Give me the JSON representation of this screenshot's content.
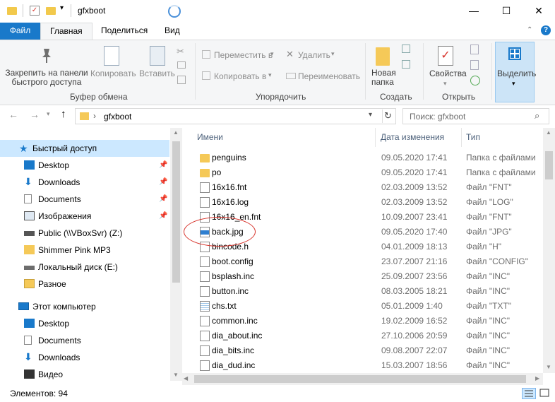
{
  "window": {
    "title": "gfxboot"
  },
  "ribbon_tabs": [
    "Файл",
    "Главная",
    "Поделиться",
    "Вид"
  ],
  "ribbon": {
    "pin_label": "Закрепить на панели быстрого доступа",
    "copy_label": "Копировать",
    "paste_label": "Вставить",
    "clipboard_group": "Буфер обмена",
    "move_to_label": "Переместить в",
    "copy_to_label": "Копировать в",
    "delete_label": "Удалить",
    "rename_label": "Переименовать",
    "organize_group": "Упорядочить",
    "new_folder_label": "Новая папка",
    "create_group": "Создать",
    "properties_label": "Свойства",
    "open_group": "Открыть",
    "select_label": "Выделить"
  },
  "address": {
    "path": "gfxboot",
    "search_placeholder": "Поиск: gfxboot"
  },
  "nav": {
    "quick_access": "Быстрый доступ",
    "items_quick": [
      "Desktop",
      "Downloads",
      "Documents",
      "Изображения",
      "Public (\\\\VBoxSvr) (Z:)",
      "Shimmer Pink MP3",
      "Локальный диск (E:)",
      "Разное"
    ],
    "this_pc": "Этот компьютер",
    "items_pc": [
      "Desktop",
      "Documents",
      "Downloads",
      "Видео"
    ]
  },
  "columns": {
    "name": "Имени",
    "date": "Дата изменения",
    "type": "Тип"
  },
  "files": [
    {
      "name": "penguins",
      "date": "09.05.2020 17:41",
      "type": "Папка с файлами",
      "kind": "folder"
    },
    {
      "name": "po",
      "date": "09.05.2020 17:41",
      "type": "Папка с файлами",
      "kind": "folder"
    },
    {
      "name": "16x16.fnt",
      "date": "02.03.2009 13:52",
      "type": "Файл \"FNT\"",
      "kind": "file"
    },
    {
      "name": "16x16.log",
      "date": "02.03.2009 13:52",
      "type": "Файл \"LOG\"",
      "kind": "file"
    },
    {
      "name": "16x16_en.fnt",
      "date": "10.09.2007 23:41",
      "type": "Файл \"FNT\"",
      "kind": "file"
    },
    {
      "name": "back.jpg",
      "date": "09.05.2020 17:40",
      "type": "Файл \"JPG\"",
      "kind": "image"
    },
    {
      "name": "bincode.h",
      "date": "04.01.2009 18:13",
      "type": "Файл \"H\"",
      "kind": "file"
    },
    {
      "name": "boot.config",
      "date": "23.07.2007 21:16",
      "type": "Файл \"CONFIG\"",
      "kind": "file"
    },
    {
      "name": "bsplash.inc",
      "date": "25.09.2007 23:56",
      "type": "Файл \"INC\"",
      "kind": "file"
    },
    {
      "name": "button.inc",
      "date": "08.03.2005 18:21",
      "type": "Файл \"INC\"",
      "kind": "file"
    },
    {
      "name": "chs.txt",
      "date": "05.01.2009 1:40",
      "type": "Файл \"TXT\"",
      "kind": "txt"
    },
    {
      "name": "common.inc",
      "date": "19.02.2009 16:52",
      "type": "Файл \"INC\"",
      "kind": "file"
    },
    {
      "name": "dia_about.inc",
      "date": "27.10.2006 20:59",
      "type": "Файл \"INC\"",
      "kind": "file"
    },
    {
      "name": "dia_bits.inc",
      "date": "09.08.2007 22:07",
      "type": "Файл \"INC\"",
      "kind": "file"
    },
    {
      "name": "dia_dud.inc",
      "date": "15.03.2007 18:56",
      "type": "Файл \"INC\"",
      "kind": "file"
    }
  ],
  "status": {
    "count": "Элементов: 94"
  },
  "colors": {
    "accent": "#1979ca",
    "annotation": "#d7332b",
    "folder": "#f5c958"
  }
}
